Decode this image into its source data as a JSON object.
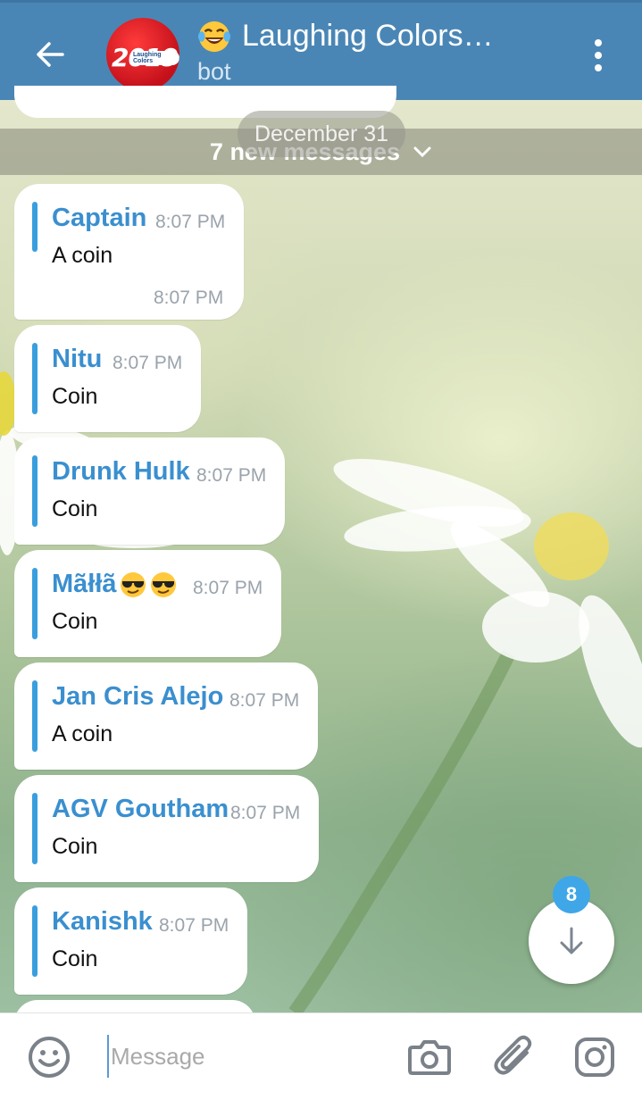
{
  "header": {
    "title": "Laughing Colors…",
    "subtitle": "bot",
    "avatar_text": "2019",
    "avatar_sub": "Laughing Colors",
    "title_emoji": "laughing-tears-emoji"
  },
  "banner": {
    "date": "December 31",
    "new_messages": "7 new messages"
  },
  "messages": [
    {
      "name": "Captain",
      "time": "8:07 PM",
      "text": "A coin",
      "footer_time": "8:07 PM"
    },
    {
      "name": "Nitu",
      "time": "8:07 PM",
      "text": "Coin"
    },
    {
      "name": "Drunk Hulk",
      "time": "8:07 PM",
      "text": "Coin"
    },
    {
      "name": "Mãłłã",
      "time": "8:07 PM",
      "text": "Coin"
    },
    {
      "name": "Jan Cris Alejo",
      "time": "8:07 PM",
      "text": "A coin"
    },
    {
      "name": "AGV Goutham",
      "time": "8:07 PM",
      "text": "Coin"
    },
    {
      "name": "Kanishk",
      "time": "8:07 PM",
      "text": "Coin"
    }
  ],
  "scroll_badge": "8",
  "composer": {
    "placeholder": "Message"
  },
  "colors": {
    "header": "#4a86b5",
    "accent": "#3a8fcf",
    "badge": "#3fa6e8"
  }
}
